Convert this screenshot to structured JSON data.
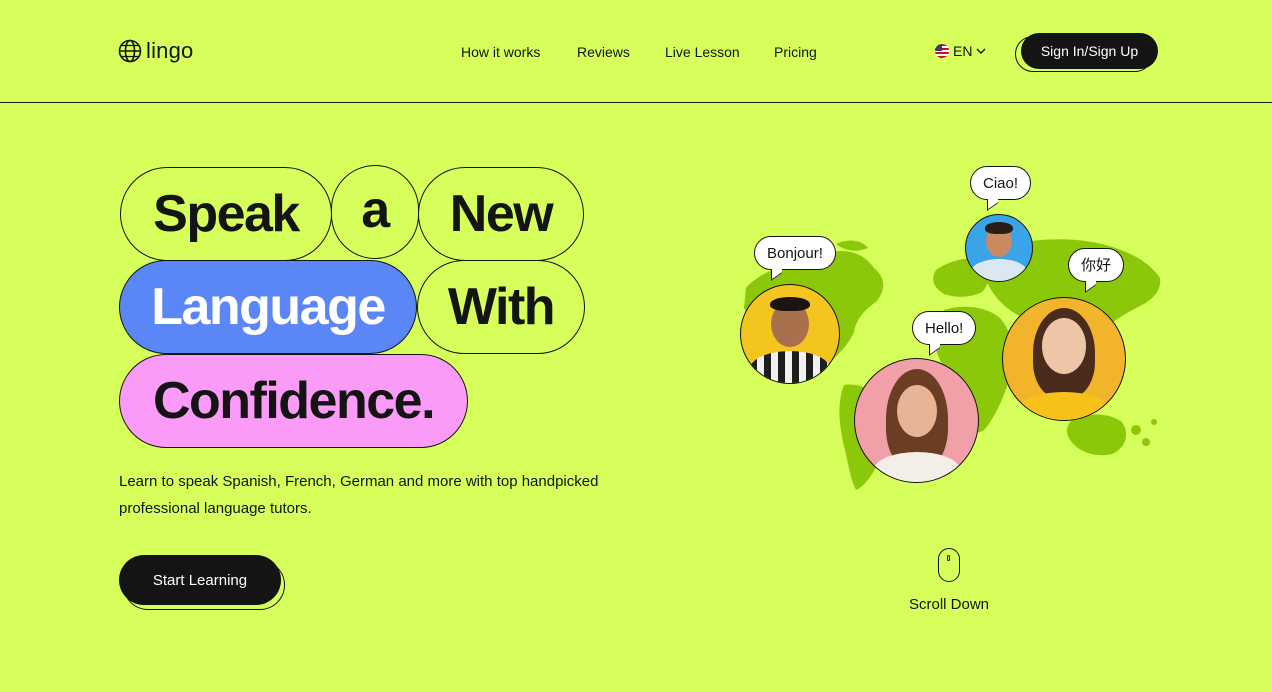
{
  "header": {
    "logo_text": "lingo",
    "nav": [
      "How it works",
      "Reviews",
      "Live Lesson",
      "Pricing"
    ],
    "language": "EN",
    "signin_label": "Sign In/Sign Up"
  },
  "hero": {
    "headline": {
      "word1": "Speak",
      "word2": "a",
      "word3": "New",
      "word4": "Language",
      "word5": "With",
      "word6": "Confidence."
    },
    "subtext": "Learn to speak Spanish, French, German and more with top handpicked professional language tutors.",
    "cta_label": "Start Learning"
  },
  "illustration": {
    "greetings": [
      "Ciao!",
      "Bonjour!",
      "你好",
      "Hello!"
    ]
  },
  "scroll_label": "Scroll Down",
  "colors": {
    "background": "#d6ff5c",
    "dark": "#141414",
    "blue_pill": "#5b87f6",
    "pink_pill": "#fb9bf8",
    "map_green": "#8cc80a"
  }
}
